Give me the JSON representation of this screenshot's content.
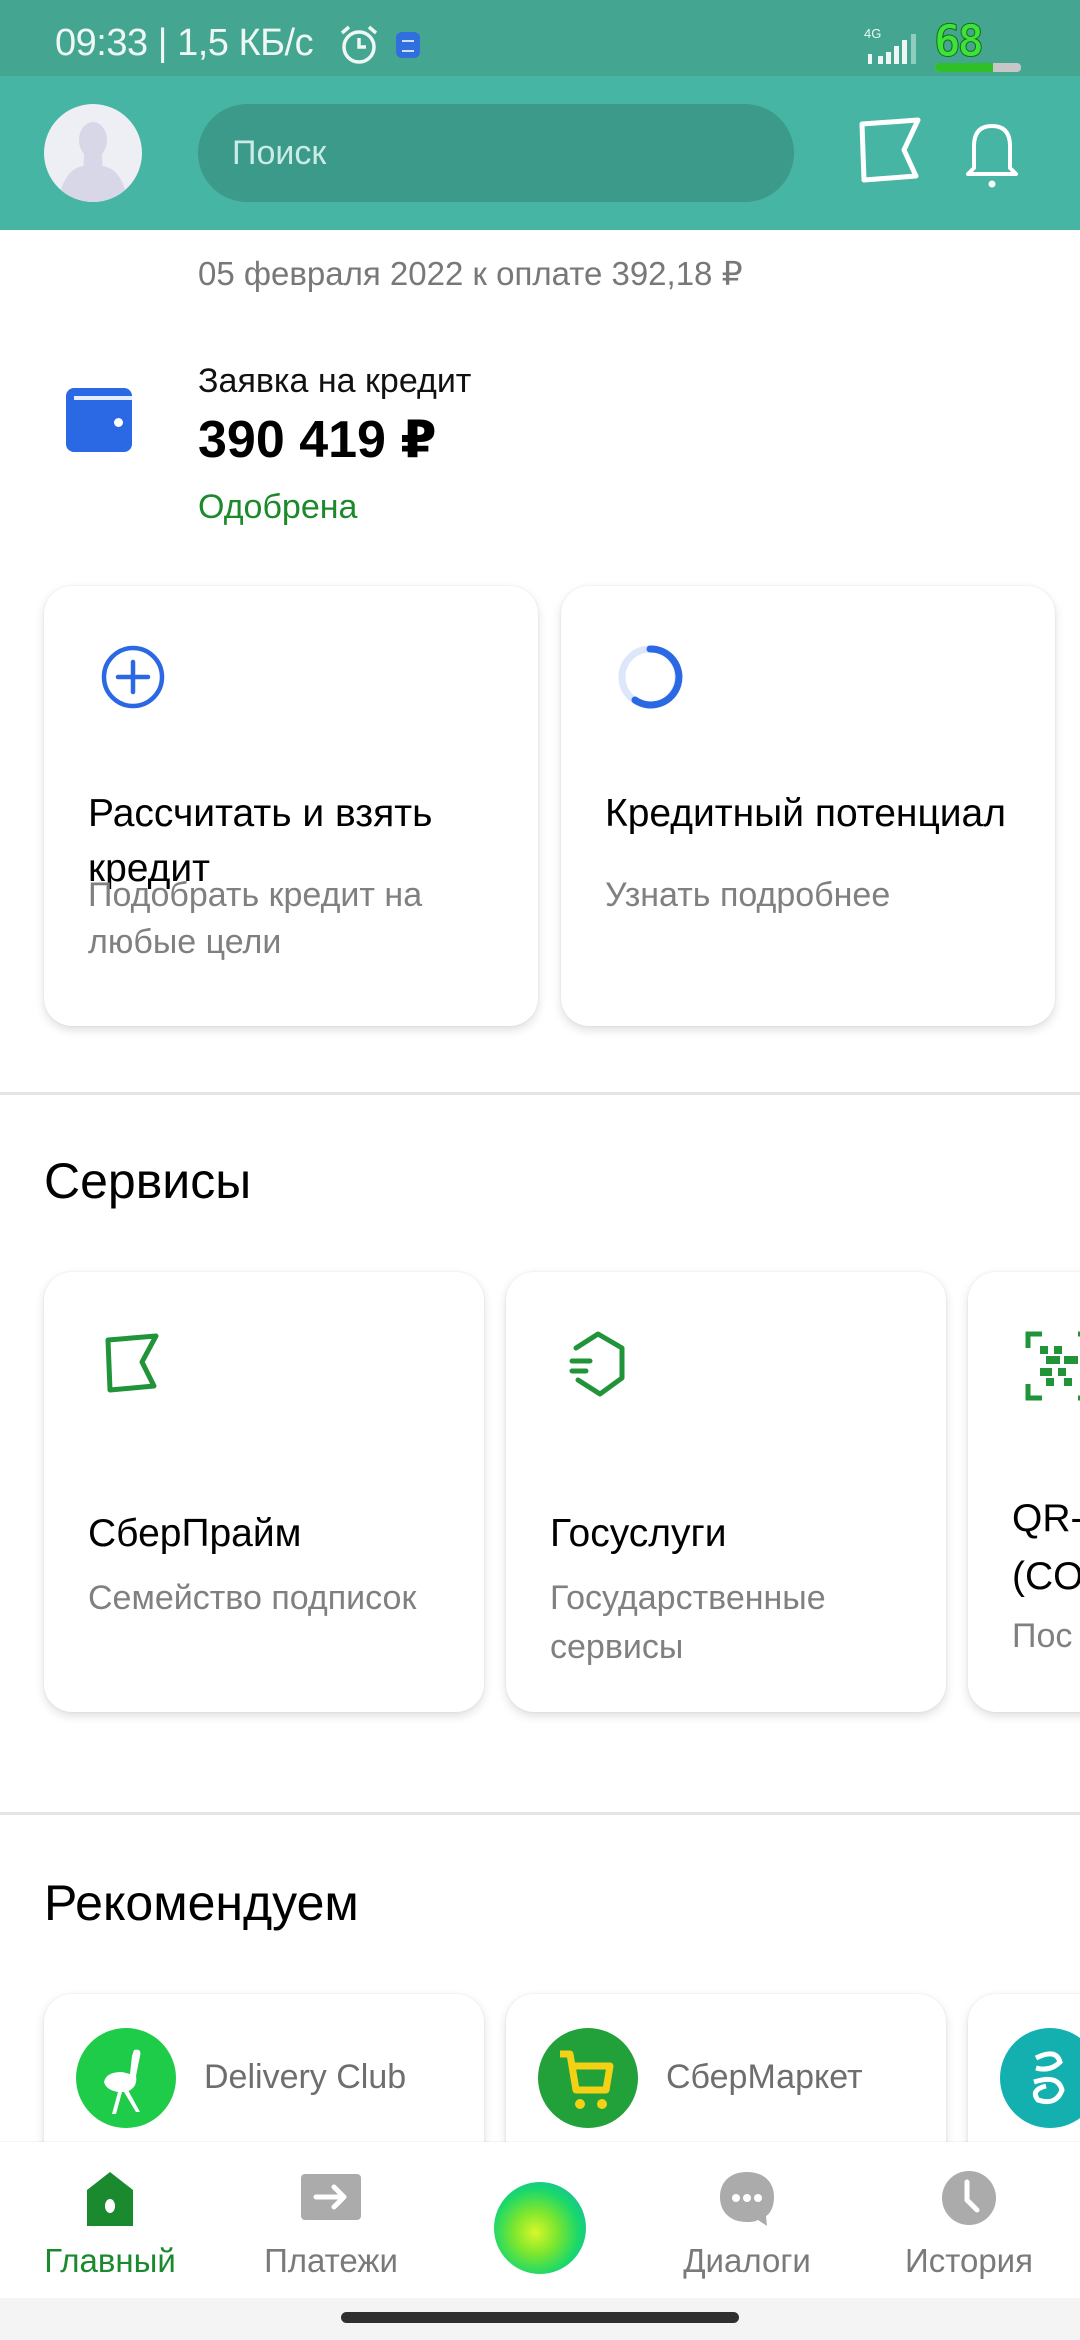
{
  "status_bar": {
    "time_speed": "09:33 | 1,5 КБ/с",
    "network": "4G",
    "battery_level": "68",
    "battery_fraction": 0.68,
    "icons": [
      "alarm-clock-icon",
      "messages-icon",
      "signal-icon",
      "battery-icon"
    ]
  },
  "header": {
    "search_placeholder": "Поиск",
    "icons": [
      "avatar",
      "sberprime-flag-icon",
      "bell-icon"
    ]
  },
  "payment": {
    "due_text": "05 февраля 2022 к оплате 392,18 ₽"
  },
  "loan_application": {
    "label": "Заявка на кредит",
    "amount": "390 419 ₽",
    "status": "Одобрена",
    "status_color": "#1c8a2b",
    "icon": "wallet-icon"
  },
  "credit_cards": [
    {
      "title": "Рассчитать и взять кредит",
      "subtitle": "Подобрать кредит на любые цели",
      "icon": "plus-circle-icon"
    },
    {
      "title": "Кредитный потенциал",
      "subtitle": "Узнать подробнее",
      "icon": "progress-ring-icon"
    }
  ],
  "services": {
    "title": "Сервисы",
    "items": [
      {
        "title": "СберПрайм",
        "subtitle": "Семейство подписок",
        "icon": "sberprime-icon"
      },
      {
        "title": "Госуслуги",
        "subtitle": "Государственные сервисы",
        "icon": "gosuslugi-icon"
      },
      {
        "title": "QR-(CO",
        "subtitle": "Пос",
        "icon": "qr-code-icon"
      }
    ]
  },
  "recommend": {
    "title": "Рекомендуем",
    "items": [
      {
        "name": "Delivery Club",
        "icon": "ostrich-icon",
        "color": "#1fcc4a"
      },
      {
        "name": "СберМаркет",
        "icon": "cart-icon",
        "color": "#22a03a"
      },
      {
        "name": "",
        "icon": "sber-app-icon",
        "color": "#14b0b0"
      }
    ]
  },
  "bottom_nav": {
    "items": [
      {
        "label": "Главный",
        "icon": "home-icon",
        "active": true
      },
      {
        "label": "Платежи",
        "icon": "payments-arrow-icon",
        "active": false
      },
      {
        "label": "",
        "icon": "salute-assistant-orb",
        "active": false
      },
      {
        "label": "Диалоги",
        "icon": "chat-bubble-icon",
        "active": false
      },
      {
        "label": "История",
        "icon": "clock-icon",
        "active": false
      }
    ]
  },
  "colors": {
    "brand_green": "#1b8a2e",
    "header_teal": "#46b5a3",
    "status_teal": "#44a690",
    "accent_blue": "#2b68e3"
  }
}
